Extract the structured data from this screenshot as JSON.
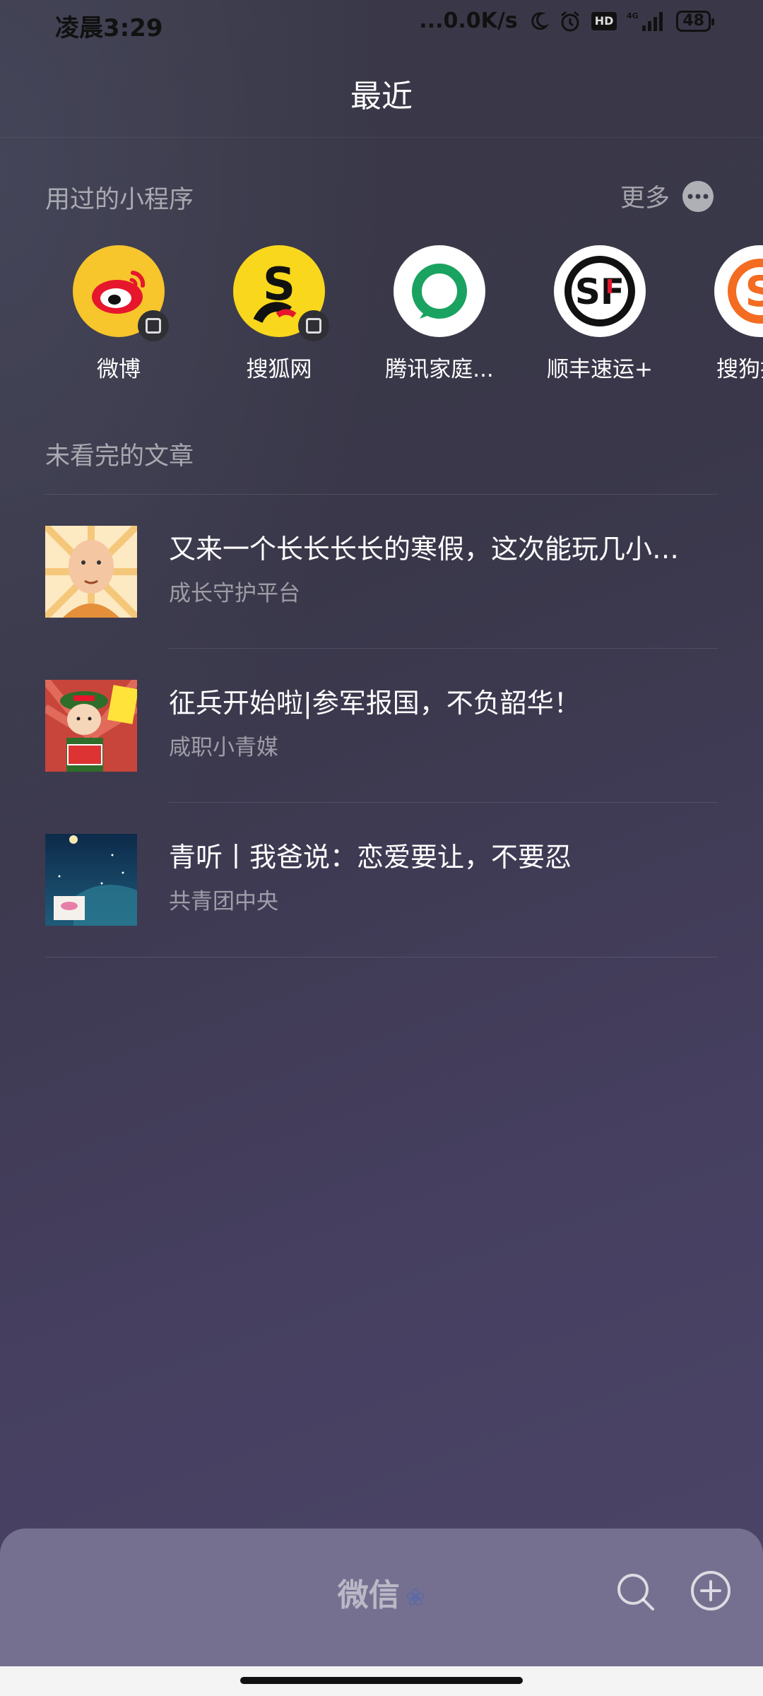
{
  "status_bar": {
    "time": "凌晨3:29",
    "network_speed": "...0.0K/s",
    "hd_label": "HD",
    "signal": "4G",
    "battery": "48"
  },
  "header": {
    "title": "最近"
  },
  "mini_programs": {
    "section_label": "用过的小程序",
    "more_label": "更多",
    "items": [
      {
        "label": "微博",
        "icon": "weibo-icon"
      },
      {
        "label": "搜狐网",
        "icon": "sohu-icon"
      },
      {
        "label": "腾讯家庭...",
        "icon": "tencent-family-icon"
      },
      {
        "label": "顺丰速运+",
        "icon": "sf-express-icon"
      },
      {
        "label": "搜狗搜索",
        "icon": "sogou-icon"
      }
    ]
  },
  "articles": {
    "section_label": "未看完的文章",
    "items": [
      {
        "title": "又来一个长长长长的寒假，这次能玩几小…",
        "source": "成长守护平台",
        "thumb": "cartoon-man"
      },
      {
        "title": "征兵开始啦|参军报国，不负韶华！",
        "source": "咸职小青媒",
        "thumb": "soldier-cartoon"
      },
      {
        "title": "青听丨我爸说：恋爱要让，不要忍",
        "source": "共青团中央",
        "thumb": "night-sky"
      }
    ]
  },
  "bottom_bar": {
    "title": "微信",
    "search_icon": "search-icon",
    "add_icon": "plus-circle-icon"
  },
  "colors": {
    "weibo": "#f7c52c",
    "sohu": "#f9d71c",
    "tencent_family": "#1aa260",
    "sf": "#111111",
    "sogou": "#f36c21",
    "bottom_bar": "#75708f"
  }
}
